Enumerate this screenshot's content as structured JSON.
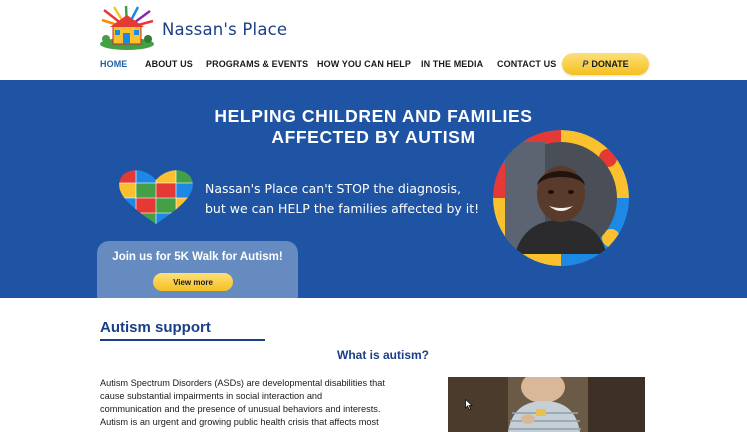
{
  "site": {
    "name": "Nassan's Place",
    "logo_icon": "crayon-house-logo-icon"
  },
  "nav": {
    "items": [
      {
        "label": "HOME",
        "active": true
      },
      {
        "label": "ABOUT US",
        "active": false
      },
      {
        "label": "PROGRAMS & EVENTS",
        "active": false
      },
      {
        "label": "HOW YOU CAN HELP",
        "active": false
      },
      {
        "label": "IN THE MEDIA",
        "active": false
      },
      {
        "label": "CONTACT US",
        "active": false
      }
    ],
    "donate_label": "DONATE",
    "donate_icon_glyph": "P",
    "donate_icon": "paypal-icon"
  },
  "hero": {
    "title_line1": "HELPING CHILDREN AND FAMILIES",
    "title_line2": "AFFECTED BY AUTISM",
    "tagline_line1": "Nassan's Place can't STOP the diagnosis,",
    "tagline_line2": "but we can HELP the families affected by it!",
    "heart_icon": "puzzle-heart-icon",
    "walk_text": "Join us for 5K Walk for Autism!",
    "view_more_label": "View more"
  },
  "content": {
    "section_heading": "Autism support",
    "question_heading": "What is autism?",
    "paragraph_lines": [
      "Autism Spectrum Disorders (ASDs) are developmental disabilities that",
      "cause substantial impairments in social interaction and",
      "communication and the presence of unusual behaviors and interests.",
      "Autism is an urgent and growing public health crisis that affects most"
    ]
  },
  "colors": {
    "brand_blue": "#1e54a3",
    "heading_blue": "#1b3f86",
    "button_yellow": "#f5bf20",
    "active_nav": "#1e5fa8"
  }
}
